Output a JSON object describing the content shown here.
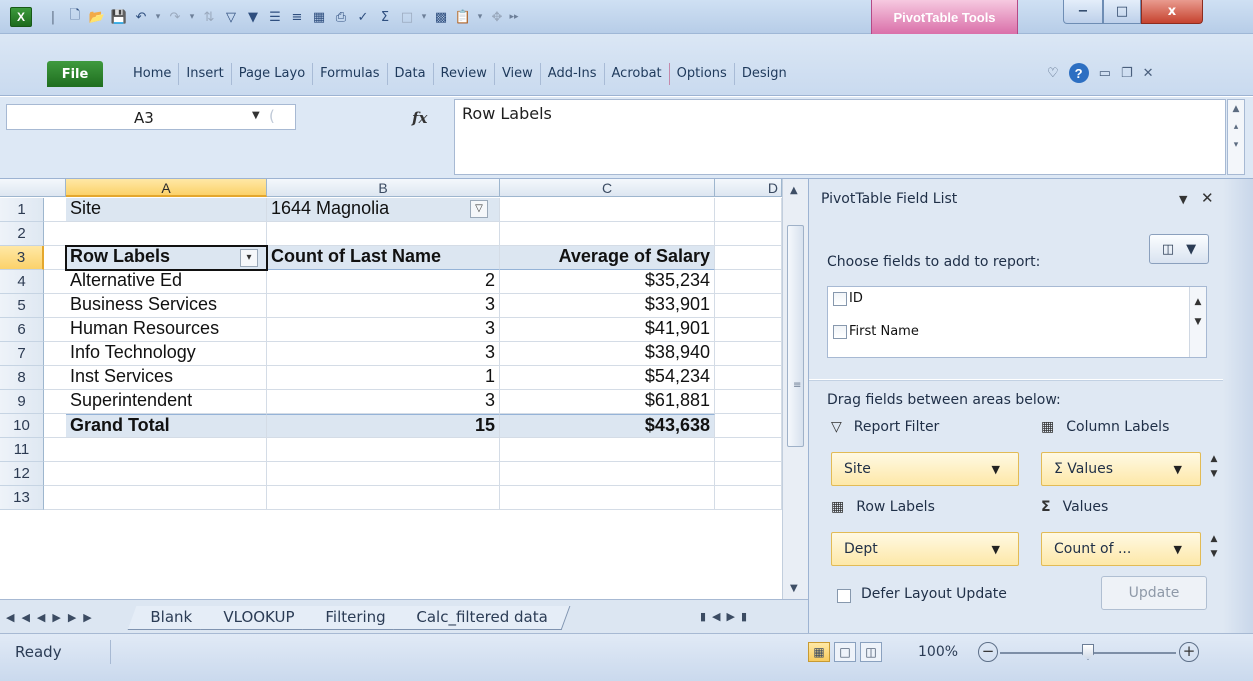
{
  "window": {
    "context_tab": "PivotTable Tools",
    "controls": {
      "minimize": "−",
      "maximize": "□",
      "close": "x"
    }
  },
  "qat": {
    "logo": "X"
  },
  "ribbon": {
    "file": "File",
    "tabs": [
      "Home",
      "Insert",
      "Page Layo",
      "Formulas",
      "Data",
      "Review",
      "View",
      "Add-Ins",
      "Acrobat",
      "Options",
      "Design"
    ]
  },
  "formula_bar": {
    "name_box": "A3",
    "fx": "fx",
    "content": "Row Labels"
  },
  "grid": {
    "columns": [
      "A",
      "B",
      "C",
      "D"
    ],
    "rows": [
      "1",
      "2",
      "3",
      "4",
      "5",
      "6",
      "7",
      "8",
      "9",
      "10",
      "11",
      "12",
      "13"
    ],
    "filter": {
      "label": "Site",
      "value": "1644 Magnolia"
    },
    "headers": {
      "row_labels": "Row Labels",
      "count": "Count of Last Name",
      "average": "Average of Salary"
    },
    "data": [
      {
        "label": "Alternative Ed",
        "count": "2",
        "avg": "$35,234"
      },
      {
        "label": "Business Services",
        "count": "3",
        "avg": "$33,901"
      },
      {
        "label": "Human Resources",
        "count": "3",
        "avg": "$41,901"
      },
      {
        "label": "Info Technology",
        "count": "3",
        "avg": "$38,940"
      },
      {
        "label": "Inst Services",
        "count": "1",
        "avg": "$54,234"
      },
      {
        "label": "Superintendent",
        "count": "3",
        "avg": "$61,881"
      }
    ],
    "total": {
      "label": "Grand Total",
      "count": "15",
      "avg": "$43,638"
    }
  },
  "sheets": [
    "Blank",
    "VLOOKUP",
    "Filtering",
    "Calc_filtered data"
  ],
  "status": {
    "ready": "Ready",
    "zoom": "100%"
  },
  "pivot_panel": {
    "title": "PivotTable Field List",
    "choose_label": "Choose fields to add to report:",
    "fields": [
      "ID",
      "First Name"
    ],
    "drag_label": "Drag fields between areas below:",
    "areas": {
      "report_filter": "Report Filter",
      "column_labels": "Column Labels",
      "row_labels": "Row Labels",
      "values": "Values"
    },
    "drops": {
      "filter": "Site",
      "columns": "Σ Values",
      "rows": "Dept",
      "values": "Count of ..."
    },
    "defer_label": "Defer Layout Update",
    "update": "Update"
  }
}
